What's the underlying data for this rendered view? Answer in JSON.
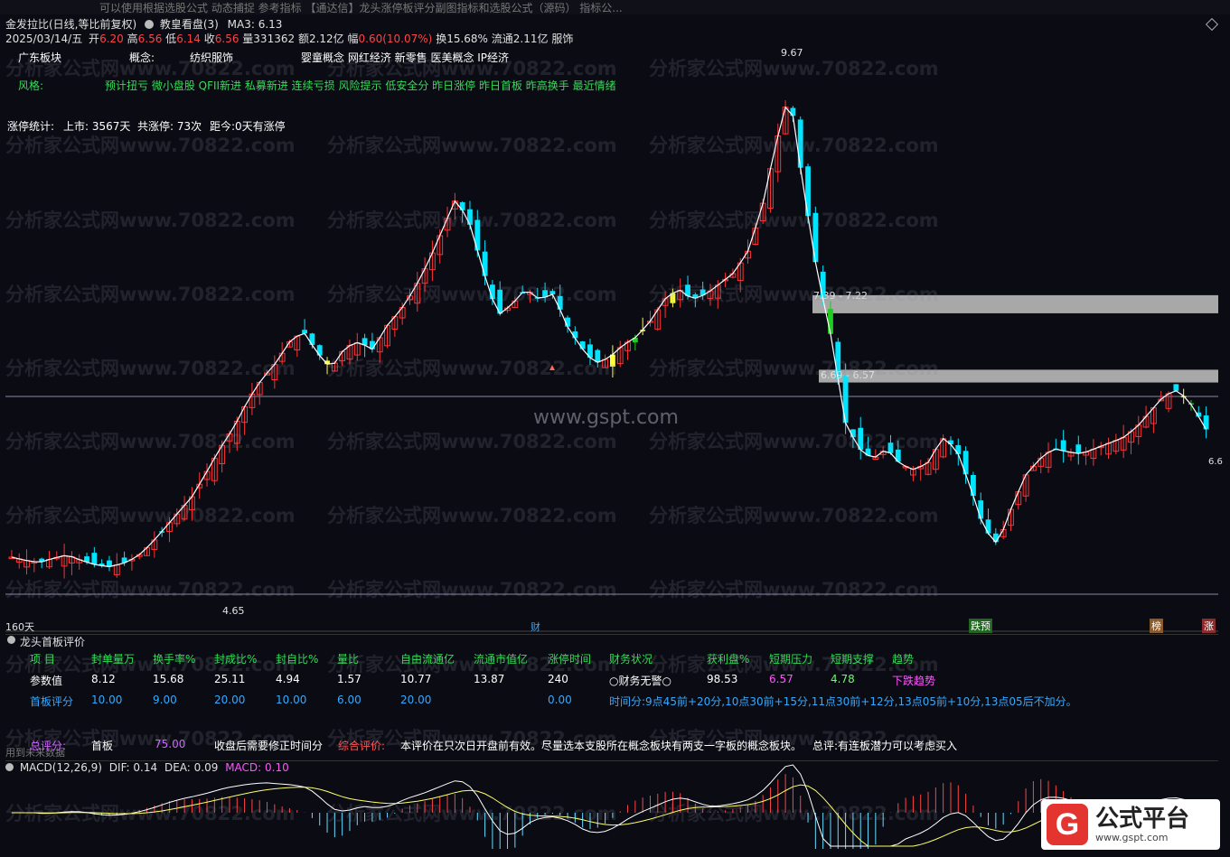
{
  "topstrip": {
    "text": "可以使用根据选股公式 动态捕捉 参考指标 【通达信】龙头涨停板评分副图指标和选股公式（源码） 指标公..."
  },
  "header": {
    "title": "金发拉比(日线,等比前复权)",
    "indicator": "教皇看盘(3)",
    "ma3": "MA3: 6.13",
    "date": "2025/03/14/五",
    "open_label": "开",
    "open": "6.20",
    "high_label": "高",
    "high": "6.56",
    "low_label": "低",
    "low": "6.14",
    "close_label": "收",
    "close": "6.56",
    "vol": "量331362",
    "amount": "额2.12亿",
    "change_label": "幅",
    "change": "0.60(10.07%)",
    "turnover": "换15.68%",
    "float": "流通2.11亿",
    "sector_tag": "服饰"
  },
  "info": {
    "board_label": "广东板块",
    "concept_label": "概念:",
    "concept_value": "纺织服饰",
    "concepts": "婴童概念 网红经济 新零售 医美概念 IP经济",
    "style_label": "风格:",
    "style_value": "预计扭亏 微小盘股 QFII新进 私募新进 连续亏损 风险提示 低安全分 昨日涨停 昨日首板 昨高换手 最近情绪",
    "stats_label": "涨停统计:",
    "listed": "上市: 3567天",
    "limit_count": "共涨停: 73次",
    "since": "距今:0天有涨停"
  },
  "chart_labels": {
    "high": "9.67",
    "low": "4.65",
    "resist1": "7.39 - 7.22",
    "resist2": "6.69 - 6.57",
    "last": "6.6",
    "days": "160天",
    "watermark_center": "www.gspt.com",
    "watermark": "分析家公式网www.70822.com",
    "marker_cai": "财",
    "marker_diegu": "跌预",
    "marker_bang": "榜",
    "marker_zhang": "涨"
  },
  "chart_data": {
    "type": "candlestick",
    "days": 160,
    "price_high": 9.67,
    "price_low": 4.65,
    "zones": [
      {
        "label": "7.39 - 7.22",
        "high": 7.39,
        "low": 7.22
      },
      {
        "label": "6.69 - 6.57",
        "high": 6.69,
        "low": 6.57
      }
    ],
    "close_path": [
      4.93,
      4.9,
      4.88,
      4.92,
      4.95,
      4.9,
      4.86,
      4.84,
      4.87,
      4.93,
      5.05,
      5.2,
      5.35,
      5.5,
      5.72,
      5.95,
      6.15,
      6.4,
      6.6,
      6.75,
      6.95,
      7.05,
      6.85,
      6.7,
      6.9,
      6.95,
      6.88,
      7.1,
      7.25,
      7.45,
      7.7,
      8.0,
      8.3,
      8.05,
      7.6,
      7.2,
      7.3,
      7.45,
      7.35,
      7.4,
      7.1,
      6.9,
      6.75,
      6.8,
      6.92,
      7.0,
      7.15,
      7.35,
      7.45,
      7.35,
      7.4,
      7.5,
      7.6,
      7.8,
      8.2,
      8.8,
      9.3,
      8.4,
      7.6,
      7.0,
      6.2,
      5.95,
      5.85,
      5.95,
      5.8,
      5.75,
      5.82,
      6.05,
      5.95,
      5.6,
      5.2,
      5.05,
      5.4,
      5.7,
      5.85,
      5.95,
      5.92,
      5.9,
      5.95,
      6.0,
      6.05,
      6.15,
      6.3,
      6.45,
      6.5,
      6.35,
      6.13
    ]
  },
  "panel": {
    "title": "龙头首板评价",
    "headers": [
      "项 目",
      "封单量万",
      "换手率%",
      "封成比%",
      "封自比%",
      "量比",
      "自由流通亿",
      "流通市值亿",
      "涨停时间",
      "财务状况",
      "获利盘%",
      "短期压力",
      "短期支撑",
      "趋势"
    ],
    "row1_label": "参数值",
    "row1": [
      "8.12",
      "15.68",
      "25.11",
      "4.94",
      "1.57",
      "10.77",
      "13.87",
      "240",
      "○财务无警○",
      "98.53",
      "6.57",
      "4.78",
      "下跌趋势"
    ],
    "row2_label": "首板评分",
    "row2": [
      "10.00",
      "9.00",
      "20.00",
      "10.00",
      "6.00",
      "20.00",
      "",
      "0.00"
    ],
    "time_rule": "时间分:9点45前+20分,10点30前+15分,11点30前+12分,13点05前+10分,13点05后不加分。",
    "total_label": "总评分:",
    "board": "首板",
    "total": "75.00",
    "note1": "收盘后需要修正时间分",
    "eval_label": "综合评价:",
    "eval_text": "本评价在只次日开盘前有效。尽量选本支股所在概念板块有两支一字板的概念板块。",
    "summary": "总评:有连板潜力可以考虑买入",
    "footer_note": "用到未来数据"
  },
  "macd": {
    "name": "MACD(12,26,9)",
    "dif": "DIF: 0.14",
    "dea": "DEA: 0.09",
    "macd": "MACD: 0.10"
  },
  "logo": {
    "name": "公式平台",
    "url": "www.gspt.com"
  },
  "colors": {
    "bg": "#0b0b14",
    "up": "#ff3333",
    "down": "#00e5ff",
    "limit_up": "#ffff33",
    "limit_break": "#22cc22"
  }
}
